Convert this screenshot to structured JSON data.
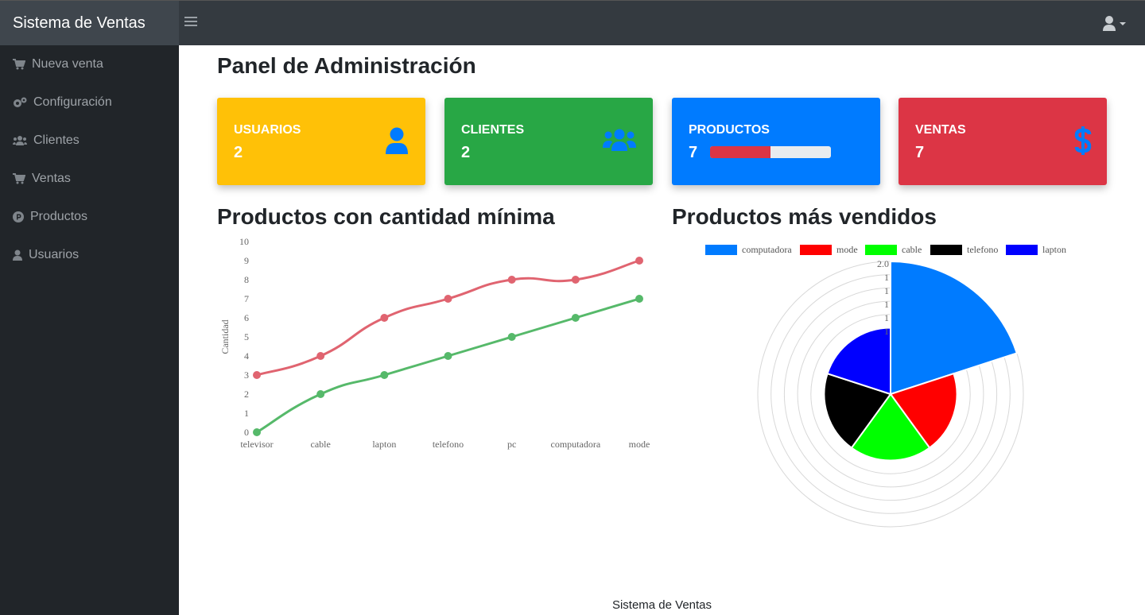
{
  "app": {
    "brand": "Sistema de Ventas"
  },
  "sidebar": {
    "items": [
      {
        "label": "Nueva venta",
        "icon": "cart-icon"
      },
      {
        "label": "Configuración",
        "icon": "cogs-icon"
      },
      {
        "label": "Clientes",
        "icon": "users-icon"
      },
      {
        "label": "Ventas",
        "icon": "cart-icon"
      },
      {
        "label": "Productos",
        "icon": "product-p-icon"
      },
      {
        "label": "Usuarios",
        "icon": "user-icon"
      }
    ]
  },
  "main": {
    "title": "Panel de Administración"
  },
  "cards": {
    "usuarios": {
      "label": "USUARIOS",
      "value": "2",
      "color": "#ffc107",
      "icon": "user-icon"
    },
    "clientes": {
      "label": "CLIENTES",
      "value": "2",
      "color": "#28a745",
      "icon": "users-icon"
    },
    "productos": {
      "label": "PRODUCTOS",
      "value": "7",
      "color": "#007bff",
      "progress_fraction": 0.5
    },
    "ventas": {
      "label": "VENTAS",
      "value": "7",
      "color": "#dc3545",
      "icon": "dollar-icon"
    }
  },
  "charts": {
    "line_title": "Productos con cantidad mínima",
    "polar_title": "Productos más vendidos"
  },
  "chart_data": [
    {
      "type": "line",
      "categories": [
        "televisor",
        "cable",
        "lapton",
        "telefono",
        "pc",
        "computadora",
        "mode"
      ],
      "series": [
        {
          "color": "#e06470",
          "values": [
            3,
            4,
            6,
            7,
            8,
            8,
            9
          ]
        },
        {
          "color": "#56b96a",
          "values": [
            0,
            2,
            3,
            4,
            5,
            6,
            7
          ]
        }
      ],
      "ylabel": "Cantidad",
      "ylim": [
        0,
        10
      ],
      "yticks": [
        "0",
        "1",
        "2",
        "3",
        "4",
        "5",
        "6",
        "7",
        "8",
        "9",
        "10"
      ],
      "grid": false
    },
    {
      "type": "polarArea",
      "categories": [
        "computadora",
        "mode",
        "cable",
        "telefono",
        "lapton"
      ],
      "values": [
        2.0,
        1.0,
        1.0,
        1.0,
        1.0
      ],
      "colors": [
        "#007bff",
        "#ff0000",
        "#00ff00",
        "#000000",
        "#0000ff"
      ],
      "rlim": [
        0,
        2.0
      ],
      "rticks": [
        "2.0",
        "1",
        "1",
        "1",
        "1",
        "1"
      ],
      "legend": "top"
    }
  ],
  "footer": {
    "text": "Sistema de Ventas"
  }
}
